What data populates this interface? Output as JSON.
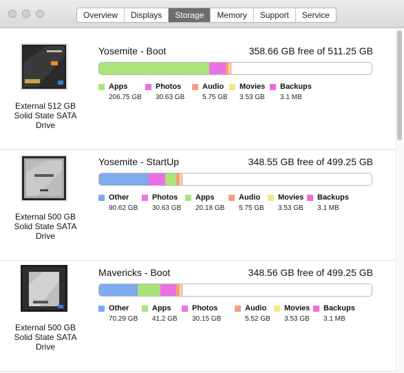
{
  "window": {
    "tabs": [
      {
        "label": "Overview",
        "active": false
      },
      {
        "label": "Displays",
        "active": false
      },
      {
        "label": "Storage",
        "active": true
      },
      {
        "label": "Memory",
        "active": false
      },
      {
        "label": "Support",
        "active": false
      },
      {
        "label": "Service",
        "active": false
      }
    ]
  },
  "colors": {
    "Other": "#7eaaee",
    "Photos": "#ee6fe4",
    "Apps": "#a8e47a",
    "Audio": "#f0a07e",
    "Movies": "#f3e87c",
    "Backups": "#ef6bd8",
    "bar_free": "#ffffff"
  },
  "drives": [
    {
      "caption": "External 512 GB\nSolid State SATA\nDrive",
      "icon": "samsung-ssd-black-icon",
      "volume": "Yosemite - Boot",
      "free": "358.66 GB free of 511.25 GB",
      "segments": [
        {
          "name": "Apps",
          "fraction": 0.404
        },
        {
          "name": "Photos",
          "fraction": 0.06
        },
        {
          "name": "Audio",
          "fraction": 0.011
        },
        {
          "name": "Movies",
          "fraction": 0.007
        },
        {
          "name": "Backups",
          "fraction": 0.002
        }
      ],
      "legend": [
        {
          "name": "Apps",
          "value": "206.75 GB"
        },
        {
          "name": "Photos",
          "value": "30.63 GB"
        },
        {
          "name": "Audio",
          "value": "5.75 GB"
        },
        {
          "name": "Movies",
          "value": "3.53 GB"
        },
        {
          "name": "Backups",
          "value": "3.1 MB"
        }
      ]
    },
    {
      "caption": "External 500 GB\nSolid State SATA\nDrive",
      "icon": "samsung-ssd-silver-icon",
      "volume": "Yosemite - StartUp",
      "free": "348.55 GB free of 499.25 GB",
      "segments": [
        {
          "name": "Other",
          "fraction": 0.182
        },
        {
          "name": "Photos",
          "fraction": 0.061
        },
        {
          "name": "Apps",
          "fraction": 0.04
        },
        {
          "name": "Audio",
          "fraction": 0.012
        },
        {
          "name": "Movies",
          "fraction": 0.007
        },
        {
          "name": "Backups",
          "fraction": 0.002
        }
      ],
      "legend": [
        {
          "name": "Other",
          "value": "90.62 GB"
        },
        {
          "name": "Photos",
          "value": "30.63 GB"
        },
        {
          "name": "Apps",
          "value": "20.18 GB"
        },
        {
          "name": "Audio",
          "value": "5.75 GB"
        },
        {
          "name": "Movies",
          "value": "3.53 GB"
        },
        {
          "name": "Backups",
          "value": "3.1 MB"
        }
      ]
    },
    {
      "caption": "External 500 GB\nSolid State SATA\nDrive",
      "icon": "samsung-840-evo-ssd-icon",
      "volume": "Mavericks - Boot",
      "free": "348.56 GB free of 499.25 GB",
      "segments": [
        {
          "name": "Other",
          "fraction": 0.141
        },
        {
          "name": "Apps",
          "fraction": 0.083
        },
        {
          "name": "Photos",
          "fraction": 0.06
        },
        {
          "name": "Audio",
          "fraction": 0.011
        },
        {
          "name": "Movies",
          "fraction": 0.007
        },
        {
          "name": "Backups",
          "fraction": 0.002
        }
      ],
      "legend": [
        {
          "name": "Other",
          "value": "70.29 GB"
        },
        {
          "name": "Apps",
          "value": "41.2 GB"
        },
        {
          "name": "Photos",
          "value": "30.15 GB"
        },
        {
          "name": "Audio",
          "value": "5.52 GB"
        },
        {
          "name": "Movies",
          "value": "3.53 GB"
        },
        {
          "name": "Backups",
          "value": "3.1 MB"
        }
      ]
    }
  ]
}
